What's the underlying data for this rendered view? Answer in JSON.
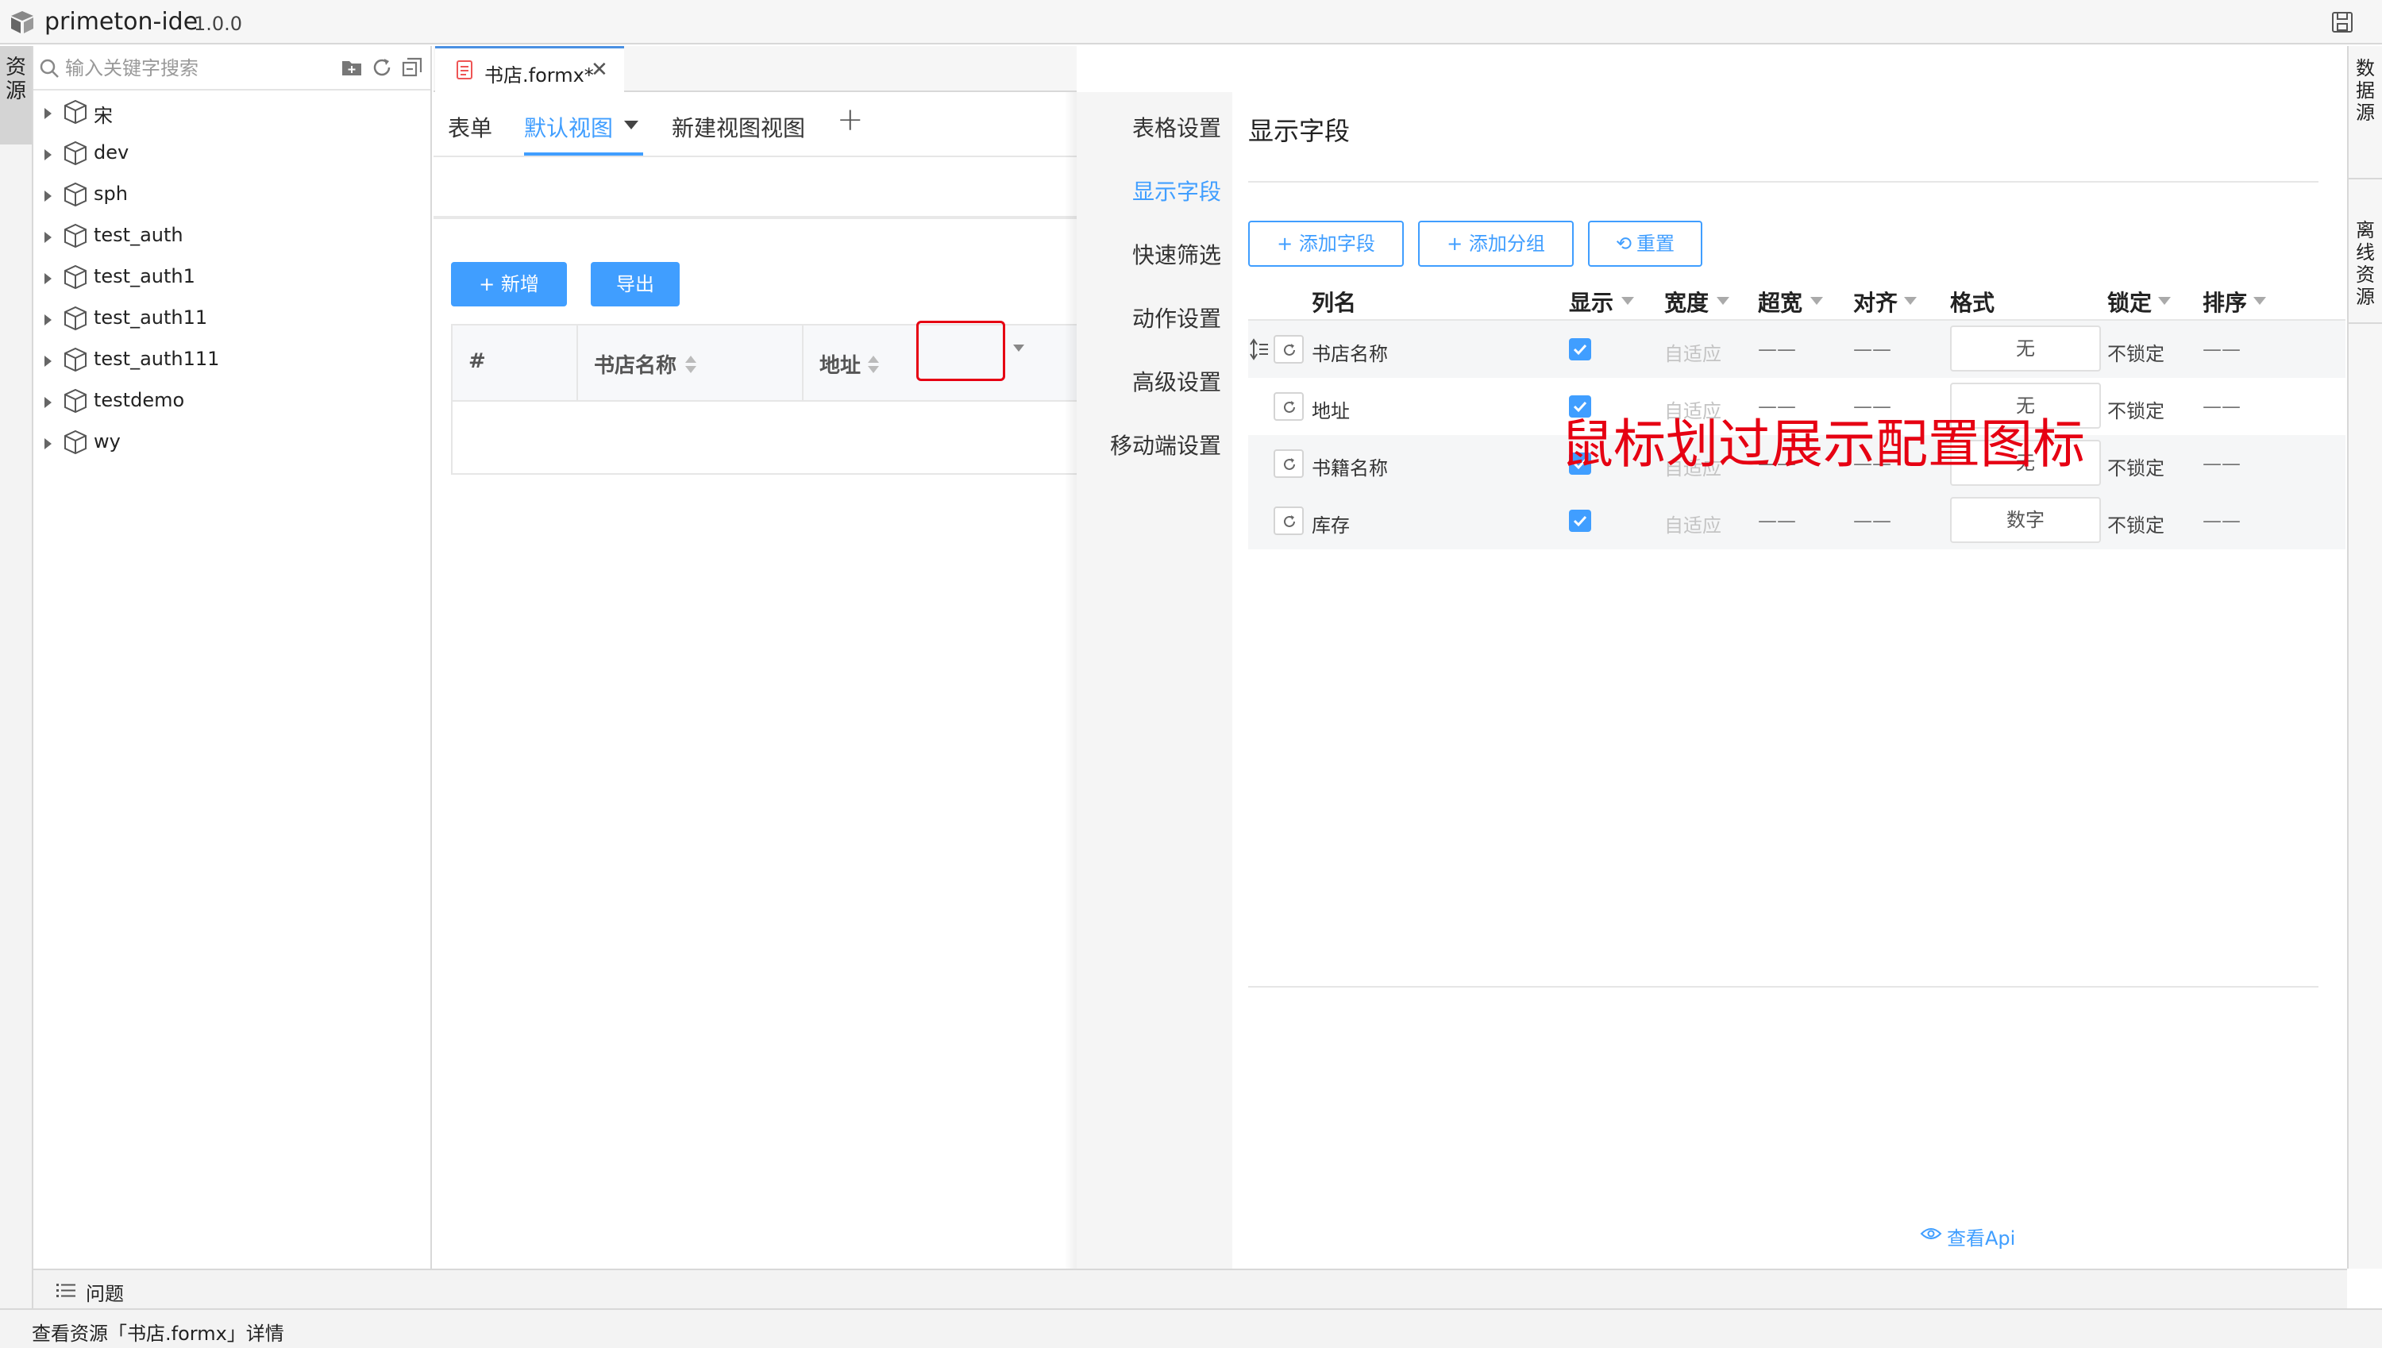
{
  "app": {
    "name": "primeton-ide",
    "version": "1.0.0"
  },
  "left_rail": {
    "resource_label": "资源"
  },
  "resource_panel": {
    "search_placeholder": "输入关键字搜索",
    "tree": [
      {
        "label": "宋"
      },
      {
        "label": "dev"
      },
      {
        "label": "sph"
      },
      {
        "label": "test_auth"
      },
      {
        "label": "test_auth1"
      },
      {
        "label": "test_auth11"
      },
      {
        "label": "test_auth111"
      },
      {
        "label": "testdemo"
      },
      {
        "label": "wy"
      }
    ]
  },
  "editor": {
    "file_tab": {
      "label": "书店.formx*"
    },
    "view_tabs": {
      "form": "表单",
      "default_view": "默认视图",
      "new_view": "新建视图视图",
      "add": "+"
    },
    "buttons": {
      "add": "+ 新增",
      "export": "导出"
    },
    "table": {
      "headers": [
        "#",
        "书店名称",
        "地址"
      ]
    }
  },
  "drawer": {
    "nav": [
      "表格设置",
      "显示字段",
      "快速筛选",
      "动作设置",
      "高级设置",
      "移动端设置"
    ],
    "active_nav": "显示字段",
    "section_title": "显示字段",
    "buttons": {
      "add_field": "+ 添加字段",
      "add_group": "+ 添加分组",
      "reset": "重置"
    },
    "columns": [
      "列名",
      "显示",
      "宽度",
      "超宽",
      "对齐",
      "格式",
      "锁定",
      "排序"
    ],
    "rows": [
      {
        "name": "书店名称",
        "show": true,
        "width": "自适应",
        "overflow": "——",
        "align": "——",
        "format": "无",
        "lock": "不锁定",
        "sort": "——"
      },
      {
        "name": "地址",
        "show": true,
        "width": "自适应",
        "overflow": "——",
        "align": "——",
        "format": "无",
        "lock": "不锁定",
        "sort": "——"
      },
      {
        "name": "书籍名称",
        "show": true,
        "width": "自适应",
        "overflow": "——",
        "align": "——",
        "format": "无",
        "lock": "不锁定",
        "sort": "——"
      },
      {
        "name": "库存",
        "show": true,
        "width": "自适应",
        "overflow": "——",
        "align": "——",
        "format": "数字",
        "lock": "不锁定",
        "sort": "——"
      }
    ],
    "annotation": "鼠标划过展示配置图标",
    "view_api": "查看Api"
  },
  "right_rail": {
    "datasource": "数据源",
    "offline": "离线资源"
  },
  "problems": {
    "label": "问题"
  },
  "status": {
    "text": "查看资源「书店.formx」详情"
  },
  "colors": {
    "accent": "#409eff",
    "annotation": "#e60012"
  }
}
